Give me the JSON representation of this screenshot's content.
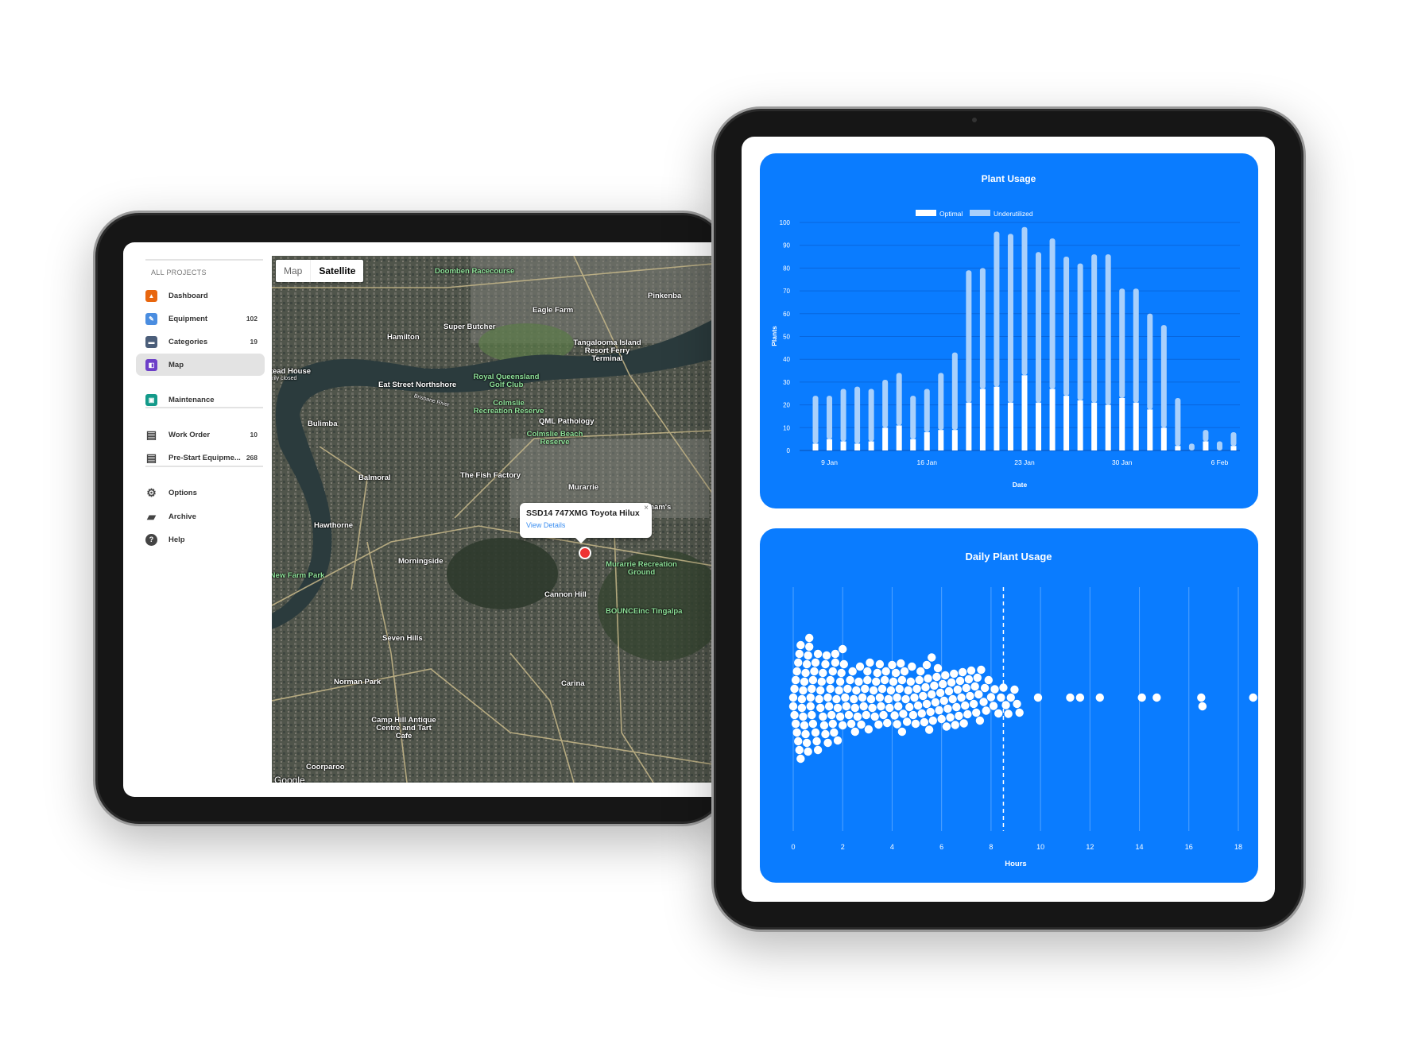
{
  "sidebar": {
    "section": "ALL PROJECTS",
    "items": [
      {
        "label": "Dashboard",
        "count": "",
        "color": "#e8660e",
        "icon": "dashboard-icon"
      },
      {
        "label": "Equipment",
        "count": "102",
        "color": "#4a8de0",
        "icon": "wrench-icon"
      },
      {
        "label": "Categories",
        "count": "19",
        "color": "#4b5e7a",
        "icon": "folder-icon"
      },
      {
        "label": "Map",
        "count": "",
        "color": "#6c3fc8",
        "icon": "map-icon",
        "active": true
      },
      {
        "label": "Maintenance",
        "count": "",
        "color": "#139a8a",
        "icon": "calendar-icon"
      },
      {
        "label": "Work Order",
        "count": "10",
        "icon": "clipboard-icon"
      },
      {
        "label": "Pre-Start Equipme...",
        "count": "268",
        "icon": "clipboard-icon"
      },
      {
        "label": "Options",
        "count": "",
        "icon": "gear-icon"
      },
      {
        "label": "Archive",
        "count": "",
        "icon": "archive-icon"
      },
      {
        "label": "Help",
        "count": "",
        "icon": "help-icon"
      }
    ]
  },
  "map": {
    "toggle": {
      "map": "Map",
      "satellite": "Satellite",
      "selected": "Satellite"
    },
    "popup": {
      "title": "SSD14 747XMG Toyota Hilux",
      "link": "View Details",
      "close": "×"
    },
    "attribution": "Google",
    "labels": [
      "Doomben Racecourse",
      "Hamilton",
      "Super Butcher",
      "Eagle Farm",
      "Pinkenba",
      "Tangalooma Island Resort Ferry Terminal",
      "Newstead House",
      "Temporarily closed",
      "Eat Street Northshore",
      "Brisbane River",
      "Royal Queensland Golf Club",
      "Colmslie Recreation Reserve",
      "QML Pathology",
      "Colmslie Beach Reserve",
      "Bulimba",
      "Balmoral",
      "The Fish Factory",
      "Murarrie",
      "Ingham's",
      "Hawthorne",
      "Morningside",
      "New Farm Park",
      "Murarrie Recreation Ground",
      "Cannon Hill",
      "BOUNCEinc Tingalpa",
      "Seven Hills",
      "Norman Park",
      "Carina",
      "Camp Hill Antique Centre and Tart Cafe",
      "Coorparoo"
    ]
  },
  "colors": {
    "card": "#0a7cff",
    "optimal": "#ffffff",
    "underutilized": "#a9d0fb"
  },
  "chart_data": [
    {
      "type": "bar",
      "stacked": true,
      "title": "Plant Usage",
      "xlabel": "Date",
      "ylabel": "Plants",
      "ylim": [
        0,
        100
      ],
      "yticks": [
        0,
        10,
        20,
        30,
        40,
        50,
        60,
        70,
        80,
        90,
        100
      ],
      "grid": true,
      "legend": "top",
      "categories": [
        "8 Jan",
        "9 Jan",
        "10 Jan",
        "11 Jan",
        "12 Jan",
        "13 Jan",
        "14 Jan",
        "15 Jan",
        "16 Jan",
        "17 Jan",
        "18 Jan",
        "19 Jan",
        "20 Jan",
        "21 Jan",
        "22 Jan",
        "23 Jan",
        "24 Jan",
        "25 Jan",
        "26 Jan",
        "27 Jan",
        "28 Jan",
        "29 Jan",
        "30 Jan",
        "31 Jan",
        "1 Feb",
        "2 Feb",
        "3 Feb",
        "4 Feb",
        "5 Feb",
        "6 Feb",
        "7 Feb"
      ],
      "xtick_labels": [
        "9 Jan",
        "16 Jan",
        "23 Jan",
        "30 Jan",
        "6 Feb"
      ],
      "series": [
        {
          "name": "Optimal",
          "values": [
            3,
            5,
            4,
            3,
            4,
            10,
            11,
            5,
            8,
            9,
            9,
            21,
            27,
            28,
            21,
            33,
            21,
            27,
            24,
            22,
            21,
            20,
            23,
            21,
            18,
            10,
            2,
            0,
            4,
            0,
            2
          ]
        },
        {
          "name": "Underutilized",
          "values": [
            21,
            19,
            23,
            25,
            23,
            21,
            23,
            19,
            19,
            25,
            34,
            58,
            53,
            68,
            74,
            65,
            66,
            66,
            61,
            60,
            65,
            66,
            48,
            50,
            42,
            45,
            21,
            3,
            5,
            4,
            6
          ]
        }
      ]
    },
    {
      "type": "scatter",
      "subtype": "beeswarm",
      "title": "Daily Plant Usage",
      "xlabel": "Hours",
      "xlim": [
        0,
        18
      ],
      "xticks": [
        0,
        2,
        4,
        6,
        8,
        10,
        12,
        14,
        16,
        18
      ],
      "grid": true,
      "reference_line": 8.5,
      "x": [
        0,
        0,
        0.05,
        0.05,
        0.1,
        0.1,
        0.15,
        0.2,
        0.2,
        0.25,
        0.3,
        0.3,
        0.35,
        0.4,
        0.4,
        0.45,
        0.5,
        0.5,
        0.55,
        0.6,
        0.6,
        0.65,
        0.7,
        0.7,
        0.75,
        0.8,
        0.8,
        0.85,
        0.9,
        0.9,
        0.95,
        1.0,
        1.0,
        0.15,
        0.35,
        0.55,
        0.75,
        0.25,
        0.45,
        0.65,
        1.05,
        1.1,
        1.1,
        1.15,
        1.2,
        1.25,
        1.3,
        1.3,
        1.35,
        1.4,
        1.45,
        1.5,
        1.5,
        1.55,
        1.6,
        1.65,
        1.7,
        1.7,
        1.75,
        1.8,
        1.85,
        1.9,
        1.9,
        1.95,
        1.2,
        1.4,
        1.6,
        1.8,
        2.0,
        2.05,
        2.1,
        2.2,
        2.25,
        2.3,
        2.4,
        2.45,
        2.5,
        2.6,
        2.65,
        2.7,
        2.8,
        2.85,
        2.9,
        2.95,
        2.15,
        2.35,
        2.55,
        2.75,
        2.5,
        2.0,
        3.0,
        3.05,
        3.1,
        3.2,
        3.25,
        3.3,
        3.4,
        3.45,
        3.5,
        3.6,
        3.65,
        3.7,
        3.8,
        3.85,
        3.9,
        3.95,
        3.15,
        3.35,
        3.55,
        3.75,
        3.5,
        3.0,
        4.0,
        4.05,
        4.1,
        4.2,
        4.25,
        4.3,
        4.35,
        4.4,
        4.45,
        4.5,
        4.6,
        4.65,
        4.7,
        4.8,
        4.85,
        4.9,
        4.95,
        4.15,
        4.55,
        4.75,
        4.4,
        4.2,
        5.0,
        5.05,
        5.1,
        5.2,
        5.25,
        5.3,
        5.35,
        5.4,
        5.45,
        5.5,
        5.6,
        5.65,
        5.7,
        5.8,
        5.85,
        5.9,
        5.95,
        5.15,
        5.55,
        5.75,
        5.4,
        5.6,
        6.0,
        6.05,
        6.1,
        6.2,
        6.25,
        6.3,
        6.4,
        6.45,
        6.5,
        6.6,
        6.65,
        6.7,
        6.8,
        6.85,
        6.9,
        6.95,
        6.15,
        6.55,
        6.35,
        6.75,
        7.0,
        7.05,
        7.1,
        7.2,
        7.3,
        7.4,
        7.45,
        7.5,
        7.6,
        7.7,
        7.8,
        7.9,
        7.15,
        7.35,
        7.55,
        7.75,
        8.0,
        8.1,
        8.15,
        8.3,
        8.4,
        8.5,
        8.6,
        8.7,
        8.8,
        8.95,
        9.05,
        9.15,
        9.9,
        11.2,
        11.6,
        12.4,
        14.1,
        14.7,
        16.5,
        16.55,
        18.6
      ]
    }
  ]
}
